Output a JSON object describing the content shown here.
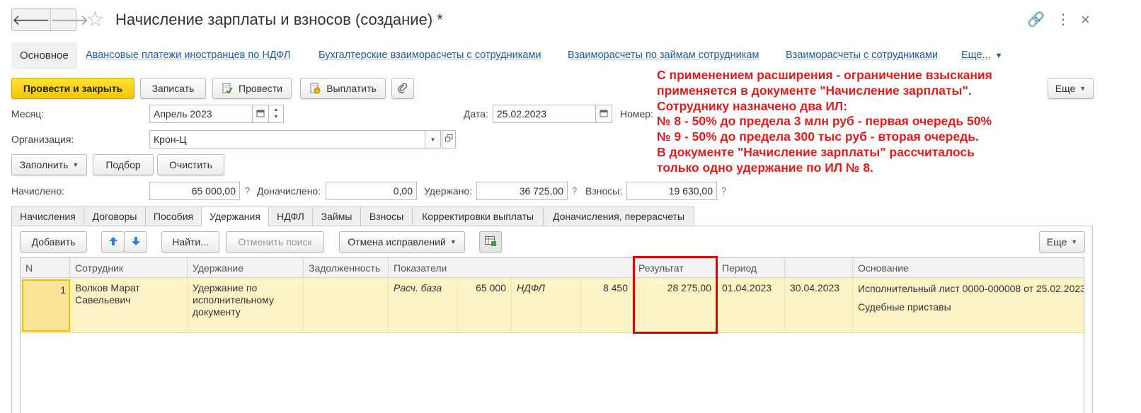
{
  "window": {
    "title": "Начисление зарплаты и взносов (создание) *"
  },
  "nav": {
    "back": "🡐",
    "forward": "🡒"
  },
  "icons": {
    "star": "☆",
    "link": "🔗",
    "more": "⋮",
    "close": "×"
  },
  "sections": {
    "main": "Основное",
    "links": [
      "Авансовые платежи иностранцев по НДФЛ",
      "Бухгалтерские взаиморасчеты с сотрудниками",
      "Взаиморасчеты по займам сотрудникам",
      "Взаиморасчеты с сотрудниками"
    ],
    "more": "Еще..."
  },
  "toolbar": {
    "post_close": "Провести и закрыть",
    "save": "Записать",
    "post": "Провести",
    "pay": "Выплатить",
    "more": "Еще"
  },
  "form": {
    "month_label": "Месяц:",
    "month_value": "Апрель 2023",
    "date_label": "Дата:",
    "date_value": "25.02.2023",
    "number_label": "Номер:",
    "org_label": "Организация:",
    "org_value": "Крон-Ц"
  },
  "fill_toolbar": {
    "fill": "Заполнить",
    "select": "Подбор",
    "clear": "Очистить"
  },
  "totals": {
    "accrued_label": "Начислено:",
    "accrued_value": "65 000,00",
    "additional_label": "Доначислено:",
    "additional_value": "0,00",
    "withheld_label": "Удержано:",
    "withheld_value": "36 725,00",
    "contributions_label": "Взносы:",
    "contributions_value": "19 630,00",
    "help": "?"
  },
  "annotation": {
    "lines": [
      "С применением расширения - ограничение взыскания",
      "применяется в документе \"Начисление зарплаты\".",
      "Сотруднику назначено два ИЛ:",
      "№ 8 - 50% до предела 3 млн руб - первая очередь 50%",
      "№ 9 - 50% до предела 300 тыс руб - вторая очередь.",
      "В документе \"Начисление зарплаты\" рассчиталось",
      "только одно удержание по ИЛ № 8."
    ],
    "color": "#e51a1a"
  },
  "tabs": [
    "Начисления",
    "Договоры",
    "Пособия",
    "Удержания",
    "НДФЛ",
    "Займы",
    "Взносы",
    "Корректировки выплаты",
    "Доначисления, перерасчеты"
  ],
  "grid_toolbar": {
    "add": "Добавить",
    "find": "Найти...",
    "cancel_search": "Отменить поиск",
    "cancel_corrections": "Отмена исправлений",
    "more": "Еще"
  },
  "grid": {
    "headers": {
      "n": "N",
      "employee": "Сотрудник",
      "deduction": "Удержание",
      "debt": "Задолженность",
      "indicators": "Показатели",
      "result": "Результат",
      "period": "Период",
      "basis": "Основание"
    },
    "row": {
      "n": "1",
      "employee_1": "Волков Марат",
      "employee_2": "Савельевич",
      "deduction_1": "Удержание по",
      "deduction_2": "исполнительному",
      "deduction_3": "документу",
      "ind1_name": "Расч. база",
      "ind1_value": "65 000",
      "ind2_name": "НДФЛ",
      "ind2_value": "8 450",
      "result": "28 275,00",
      "period_start": "01.04.2023",
      "period_end": "30.04.2023",
      "basis_1": "Исполнительный лист 0000-000008 от 25.02.2023",
      "basis_2": "Судебные приставы"
    }
  },
  "colors": {
    "primary_button": "#f5cd0a",
    "link": "#1a5ba0",
    "row_highlight": "#fdf3c6",
    "highlight_box": "#e00000"
  }
}
